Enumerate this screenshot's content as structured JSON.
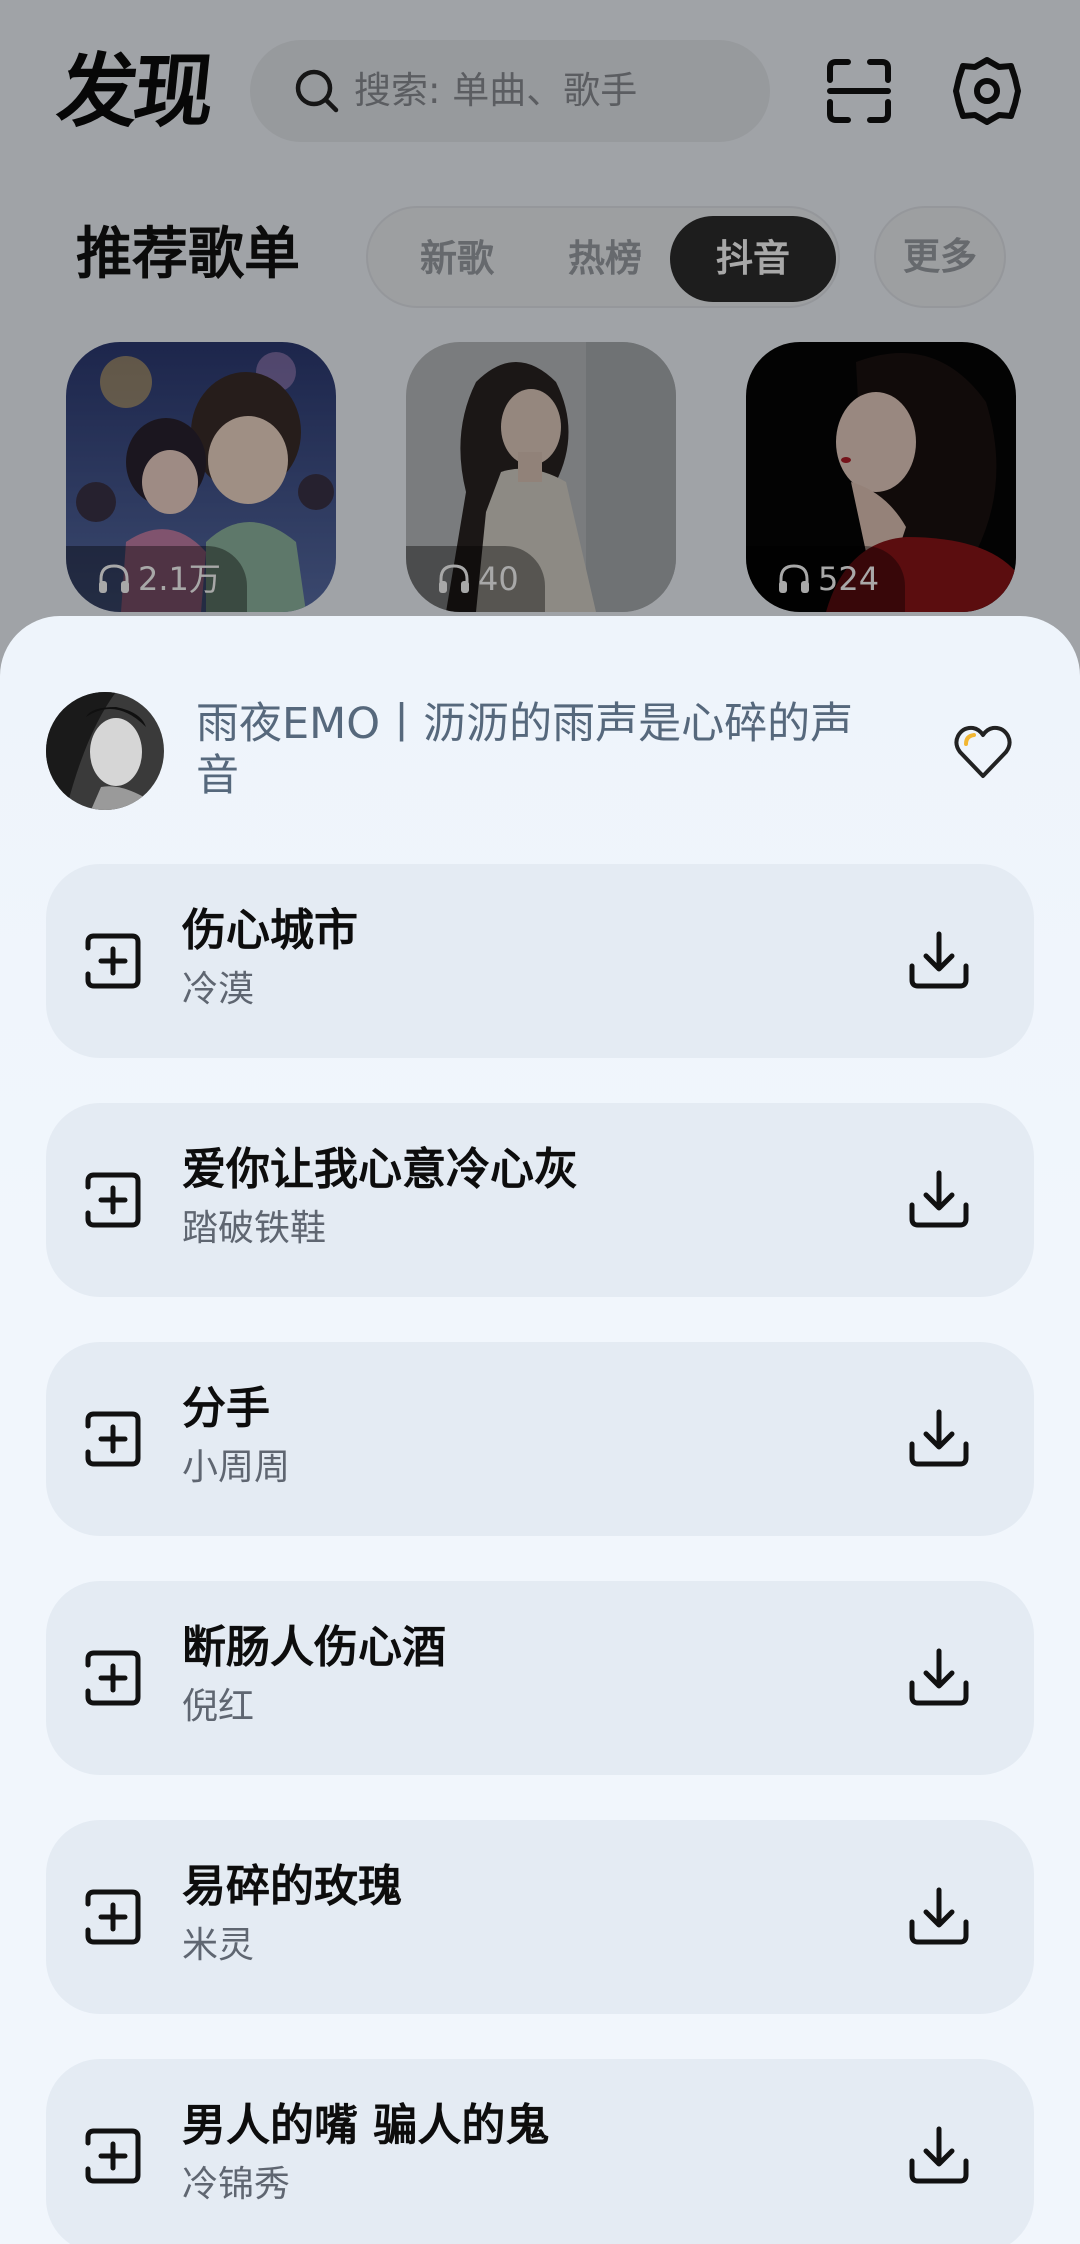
{
  "header": {
    "title": "发现",
    "search_placeholder": "搜索: 单曲、歌手",
    "icons": [
      "search-icon",
      "scan-icon",
      "gear-icon"
    ]
  },
  "section": {
    "title": "推荐歌单",
    "tabs": [
      {
        "label": "新歌",
        "active": false
      },
      {
        "label": "热榜",
        "active": false
      },
      {
        "label": "抖音",
        "active": true
      }
    ],
    "more_label": "更多"
  },
  "playlists": [
    {
      "plays": "2.1万"
    },
    {
      "plays": "40"
    },
    {
      "plays": "524"
    }
  ],
  "sheet": {
    "playlist_title": "雨夜EMO丨沥沥的雨声是心碎的声音",
    "songs": [
      {
        "title": "伤心城市",
        "artist": "冷漠"
      },
      {
        "title": "爱你让我心意冷心灰",
        "artist": "踏破铁鞋"
      },
      {
        "title": "分手",
        "artist": "小周周"
      },
      {
        "title": "断肠人伤心酒",
        "artist": "倪红"
      },
      {
        "title": "易碎的玫瑰",
        "artist": "米灵"
      },
      {
        "title": "男人的嘴 骗人的鬼",
        "artist": "冷锦秀"
      }
    ]
  },
  "colors": {
    "sheet_background": "#f1f6fc",
    "song_card": "#e4ebf3",
    "active_tab": "#2c2c2c",
    "favorite_accent": "#f2b632"
  }
}
